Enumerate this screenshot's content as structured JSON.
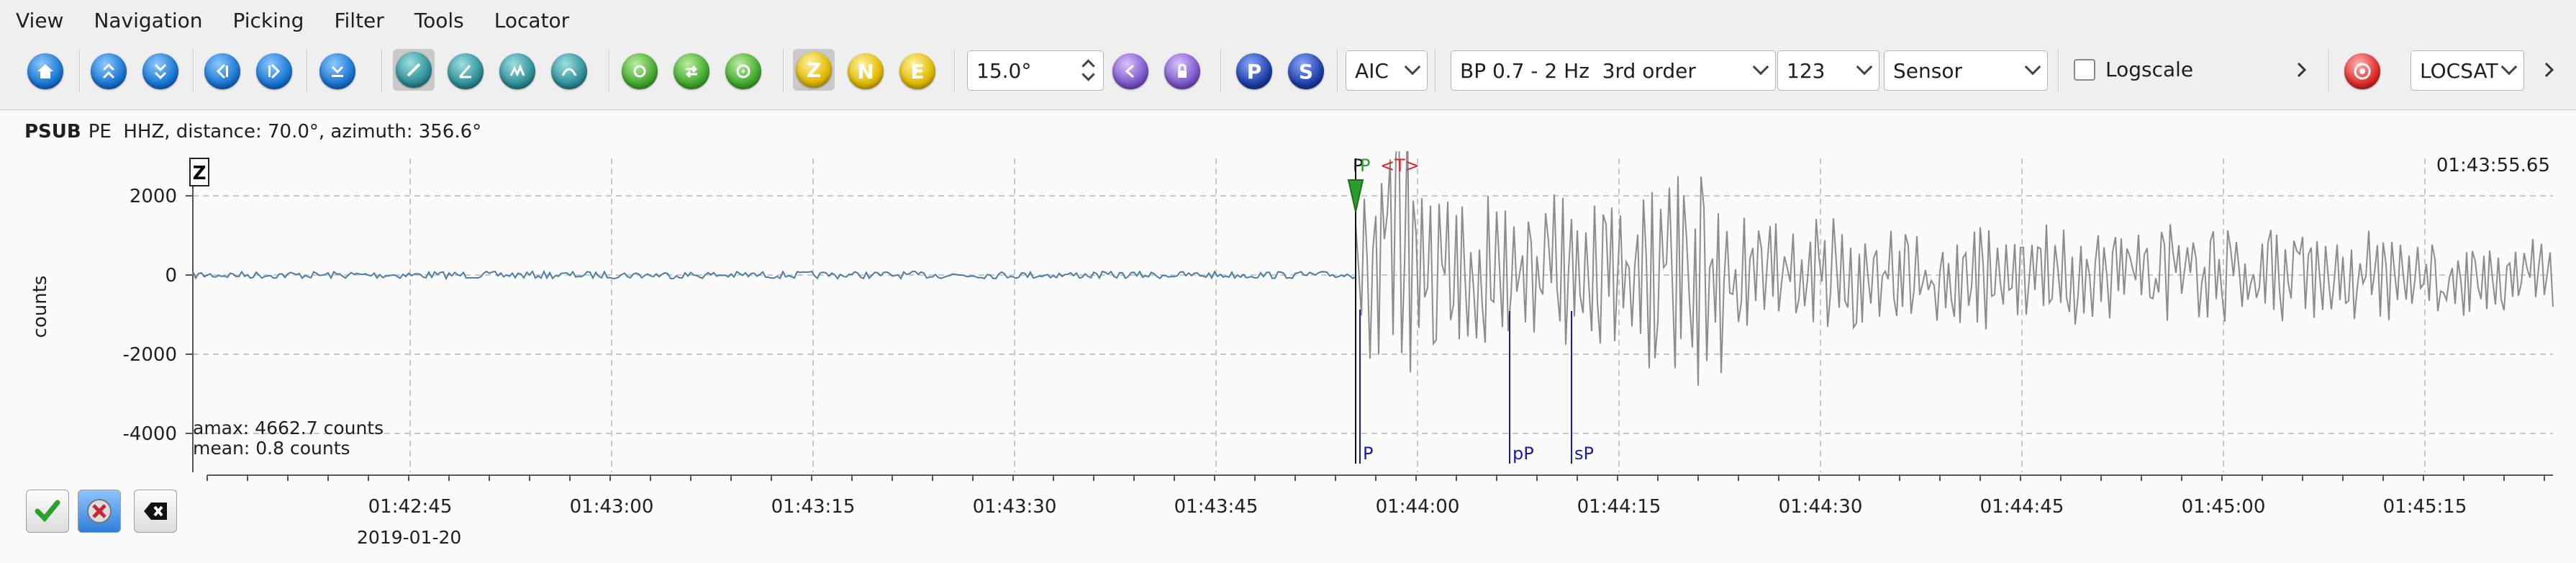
{
  "menu": [
    "View",
    "Navigation",
    "Picking",
    "Filter",
    "Tools",
    "Locator"
  ],
  "toolbar": {
    "component_z": "Z",
    "component_n": "N",
    "component_e": "E",
    "filter_angle": "15.0°",
    "phase_p": "P",
    "phase_s": "S",
    "picker_method": "AIC",
    "filter": "BP 0.7 - 2 Hz  3rd order",
    "channel_set": "123",
    "unit_mode": "Sensor",
    "logscale_label": "Logscale",
    "logscale_checked": false,
    "locator": "LOCSAT"
  },
  "trace": {
    "station": "PSUB",
    "network_channel": "PE  HHZ, distance: 70.0°, azimuth: 356.6°",
    "component_badge": "Z",
    "ylabel": "counts",
    "time_label": "01:43:55.65",
    "amax": "amax: 4662.7 counts",
    "mean": "mean: 0.8 counts",
    "date": "2019-01-20"
  },
  "chart_data": {
    "type": "line",
    "ylabel": "counts",
    "yticks": [
      2000,
      0,
      -2000,
      -4000
    ],
    "ylim": [
      -4800,
      2900
    ],
    "xticks": [
      "01:42:45",
      "01:43:00",
      "01:43:15",
      "01:43:30",
      "01:43:45",
      "01:44:00",
      "01:44:15",
      "01:44:30",
      "01:44:45",
      "01:45:00",
      "01:45:15"
    ],
    "grid": true,
    "series_color": "#8c8c8c",
    "noise_color": "#4a7ea8",
    "picks": [
      {
        "label": "P",
        "color": "#111111",
        "type": "pick-top"
      },
      {
        "label": "P",
        "color": "#2a9d2a",
        "type": "pick-top"
      },
      {
        "label": "<T>",
        "color": "#e0242b",
        "type": "pick-top"
      }
    ],
    "theoretical": [
      {
        "label": "P",
        "color": "#1a1aa8"
      },
      {
        "label": "pP",
        "color": "#1a1aa8"
      },
      {
        "label": "sP",
        "color": "#1a1aa8"
      }
    ]
  }
}
